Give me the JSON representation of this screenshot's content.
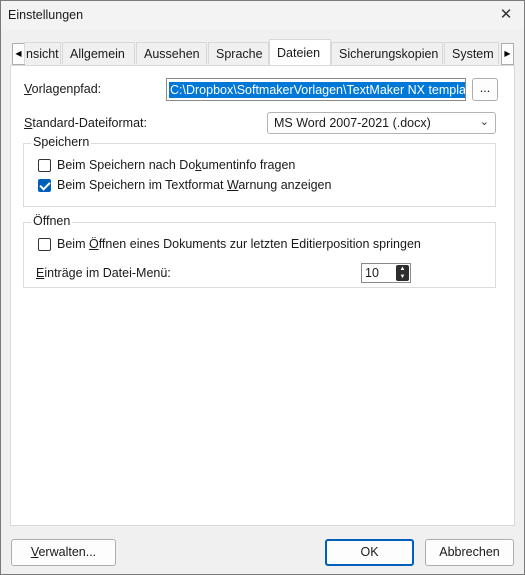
{
  "window": {
    "title": "Einstellungen",
    "close_glyph": "✕"
  },
  "tabs": {
    "scroll_left": "◀",
    "scroll_right": "▶",
    "items": [
      {
        "label": "nsicht",
        "active": false
      },
      {
        "label": "Allgemein",
        "active": false
      },
      {
        "label": "Aussehen",
        "active": false
      },
      {
        "label": "Sprache",
        "active": false
      },
      {
        "label": "Dateien",
        "active": true
      },
      {
        "label": "Sicherungskopien",
        "active": false
      },
      {
        "label": "System",
        "active": false
      }
    ]
  },
  "template_path": {
    "label_first": "V",
    "label_rest": "orlagenpfad:",
    "value": "C:\\Dropbox\\SoftmakerVorlagen\\TextMaker NX templates",
    "browse_label": "..."
  },
  "default_format": {
    "label_first": "S",
    "label_rest": "tandard-Dateiformat:",
    "selected": "MS Word 2007-2021 (.docx)",
    "chevron": "⌄"
  },
  "save_group": {
    "title": "Speichern",
    "options": [
      {
        "pre": "Beim Speichern nach Do",
        "key": "k",
        "post": "umentinfo fragen",
        "checked": false
      },
      {
        "pre": "Beim Speichern im Textformat ",
        "key": "W",
        "post": "arnung anzeigen",
        "checked": true
      }
    ]
  },
  "open_group": {
    "title": "Öffnen",
    "options": [
      {
        "pre": "Beim ",
        "key": "Ö",
        "post": "ffnen eines Dokuments zur letzten Editierposition springen",
        "checked": false
      }
    ],
    "menu_entries": {
      "label_first": "E",
      "label_rest": "inträge im Datei-Menü:",
      "value": "10",
      "up": "▲",
      "down": "▼"
    }
  },
  "buttons": {
    "manage_first": "V",
    "manage_rest": "erwalten...",
    "ok": "OK",
    "cancel": "Abbrechen"
  },
  "colors": {
    "accent": "#005fb8",
    "selection": "#0078d7"
  }
}
